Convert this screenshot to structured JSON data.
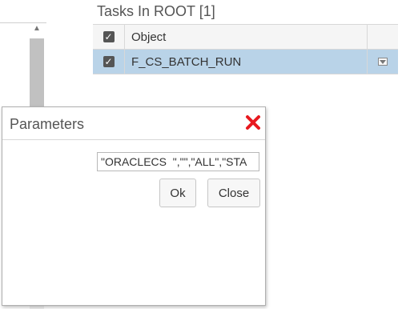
{
  "tasks_panel": {
    "title": "Tasks In ROOT [1]",
    "header": {
      "object_label": "Object",
      "checked": true
    },
    "rows": [
      {
        "object": "F_CS_BATCH_RUN",
        "checked": true,
        "selected": true
      }
    ],
    "colors": {
      "selected_row": "#b9d3e8",
      "header_bg": "#f5f5f5"
    }
  },
  "dialog": {
    "title": "Parameters",
    "close_icon": "close-x-icon",
    "close_icon_color": "#e8191f",
    "param_value": "\"ORACLECS  \",\"\",\"ALL\",\"STA",
    "ok_label": "Ok",
    "close_label": "Close"
  },
  "left_scrollbar": {
    "up_icon": "triangle-up-icon"
  }
}
